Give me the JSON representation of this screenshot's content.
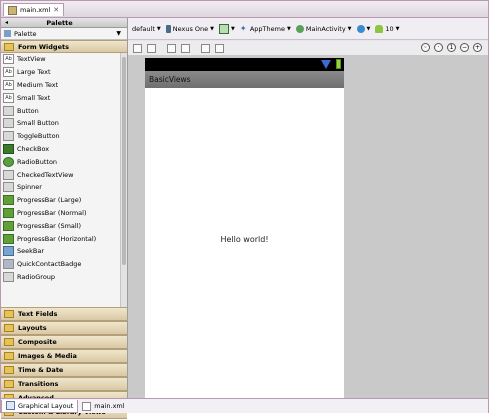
{
  "editor": {
    "tab_title": "main.xml"
  },
  "palette": {
    "header": "Palette",
    "selector": "Palette",
    "active_category": "Form Widgets",
    "widgets": [
      {
        "label": "TextView",
        "icon": "ab"
      },
      {
        "label": "Large Text",
        "icon": "ab"
      },
      {
        "label": "Medium Text",
        "icon": "ab"
      },
      {
        "label": "Small Text",
        "icon": "ab"
      },
      {
        "label": "Button",
        "icon": "btn"
      },
      {
        "label": "Small Button",
        "icon": "btn"
      },
      {
        "label": "ToggleButton",
        "icon": "btn"
      },
      {
        "label": "CheckBox",
        "icon": "chk"
      },
      {
        "label": "RadioButton",
        "icon": "rad"
      },
      {
        "label": "CheckedTextView",
        "icon": "btn"
      },
      {
        "label": "Spinner",
        "icon": "btn"
      },
      {
        "label": "ProgressBar (Large)",
        "icon": "bar"
      },
      {
        "label": "ProgressBar (Normal)",
        "icon": "bar"
      },
      {
        "label": "ProgressBar (Small)",
        "icon": "bar"
      },
      {
        "label": "ProgressBar (Horizontal)",
        "icon": "bar"
      },
      {
        "label": "SeekBar",
        "icon": "seek"
      },
      {
        "label": "QuickContactBadge",
        "icon": "qc"
      },
      {
        "label": "RadioGroup",
        "icon": "btn"
      }
    ],
    "categories": [
      "Text Fields",
      "Layouts",
      "Composite",
      "Images & Media",
      "Time & Date",
      "Transitions",
      "Advanced",
      "Custom & Library Views"
    ]
  },
  "toolbar": {
    "config": "default",
    "device": "Nexus One",
    "theme": "AppTheme",
    "activity": "MainActivity",
    "api": "10"
  },
  "device_preview": {
    "app_title": "BasicViews",
    "content_text": "Hello world!"
  },
  "bottom_tabs": {
    "graphical": "Graphical Layout",
    "xml": "main.xml"
  }
}
